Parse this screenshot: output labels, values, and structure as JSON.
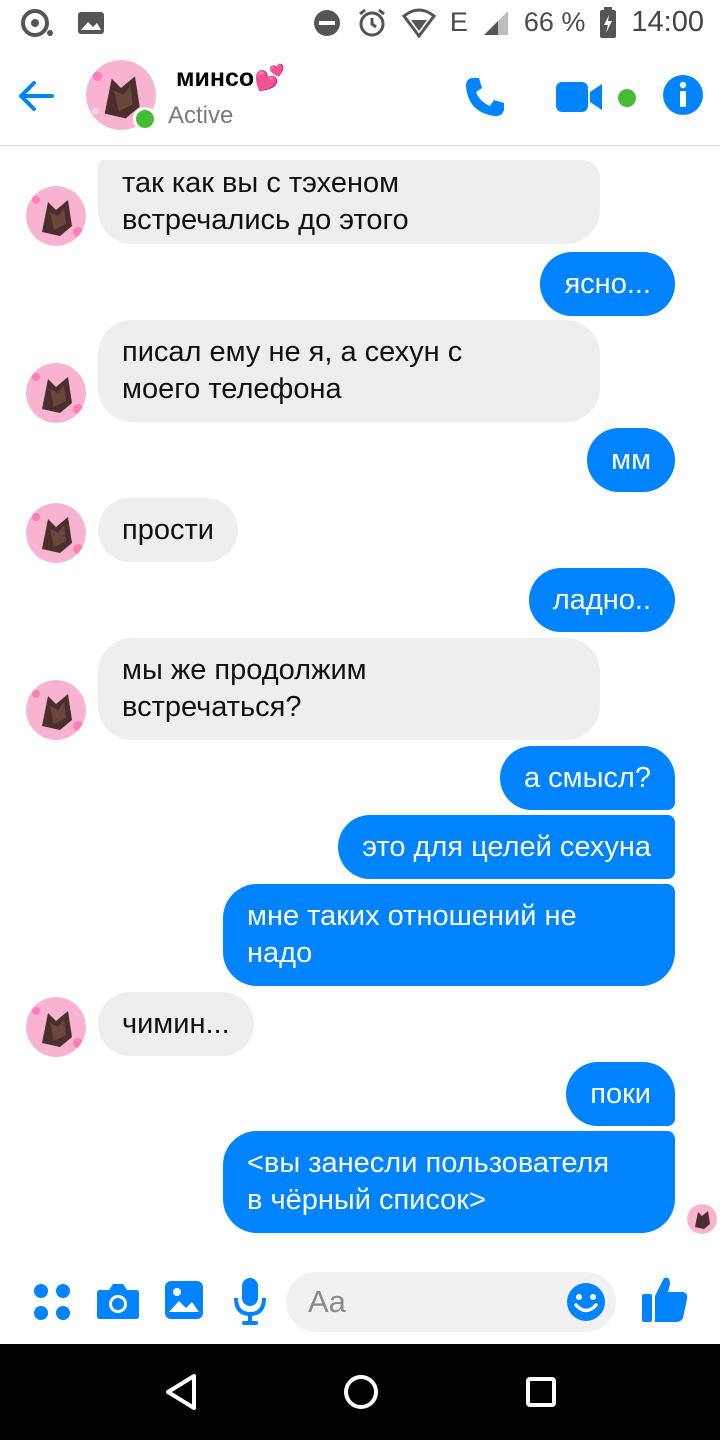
{
  "status_bar": {
    "battery": "66 %",
    "network": "E",
    "time": "14:00"
  },
  "header": {
    "name": "минсо💕",
    "status": "Active"
  },
  "messages": [
    {
      "dir": "in",
      "text": "так как вы с тэхеном\nвстречались до этого"
    },
    {
      "dir": "out",
      "text": "ясно..."
    },
    {
      "dir": "in",
      "text": "писал ему не я, а сехун с\nмоего телефона"
    },
    {
      "dir": "out",
      "text": "мм"
    },
    {
      "dir": "in",
      "text": "прости"
    },
    {
      "dir": "out",
      "text": "ладно.."
    },
    {
      "dir": "in",
      "text": "мы же продолжим\nвстречаться?"
    },
    {
      "dir": "out",
      "text": "а смысл?"
    },
    {
      "dir": "out",
      "text": "это для целей сехуна"
    },
    {
      "dir": "out",
      "text": "мне таких отношений не\nнадо"
    },
    {
      "dir": "in",
      "text": "чимин..."
    },
    {
      "dir": "out",
      "text": "поки"
    },
    {
      "dir": "out",
      "text": "<вы занесли пользователя\nв чёрный список>"
    }
  ],
  "composer": {
    "placeholder": "Aa"
  },
  "icons": {
    "back": "back-arrow-icon",
    "call": "phone-icon",
    "video": "video-camera-icon",
    "info": "info-icon",
    "more": "four-dots-icon",
    "camera": "camera-icon",
    "gallery": "image-icon",
    "mic": "microphone-icon",
    "emoji": "emoji-icon",
    "like": "thumbs-up-icon",
    "nav_back": "triangle-back-icon",
    "nav_home": "circle-home-icon",
    "nav_recents": "square-recents-icon"
  },
  "colors": {
    "accent": "#0083ff",
    "incoming_bubble": "#eeeeee",
    "online": "#44bc34"
  }
}
